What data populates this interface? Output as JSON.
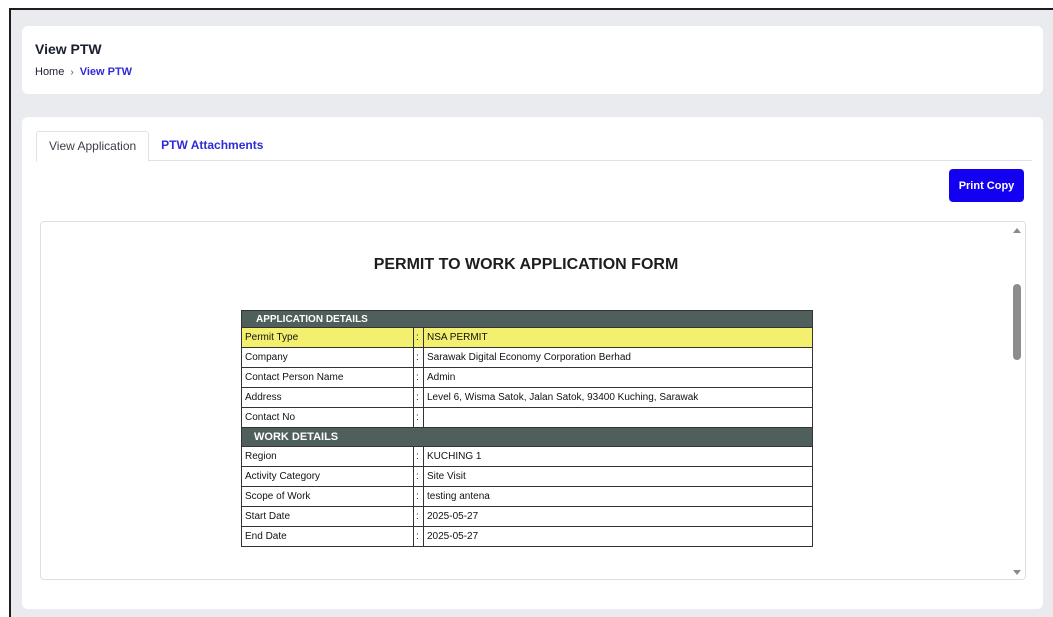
{
  "header": {
    "title": "View PTW",
    "breadcrumb": {
      "home": "Home",
      "separator": "›",
      "current": "View PTW"
    }
  },
  "tabs": [
    {
      "label": "View Application",
      "active": true
    },
    {
      "label": "PTW Attachments",
      "active": false
    }
  ],
  "toolbar": {
    "print_label": "Print Copy"
  },
  "document": {
    "title": "PERMIT TO WORK APPLICATION FORM",
    "sections": {
      "application": {
        "heading": "APPLICATION DETAILS",
        "rows": [
          {
            "label": "Permit Type",
            "value": "NSA PERMIT"
          },
          {
            "label": "Company",
            "value": "Sarawak Digital Economy Corporation Berhad"
          },
          {
            "label": "Contact Person Name",
            "value": "Admin"
          },
          {
            "label": "Address",
            "value": "Level 6, Wisma Satok, Jalan Satok, 93400 Kuching, Sarawak"
          },
          {
            "label": "Contact No",
            "value": ""
          }
        ]
      },
      "work": {
        "heading": "WORK DETAILS",
        "rows": [
          {
            "label": "Region",
            "value": "KUCHING 1"
          },
          {
            "label": "Activity Category",
            "value": "Site Visit"
          },
          {
            "label": "Scope of Work",
            "value": "testing antena"
          },
          {
            "label": "Start Date",
            "value": "2025-05-27"
          },
          {
            "label": "End Date",
            "value": "2025-05-27"
          }
        ]
      }
    },
    "colon": ":"
  },
  "colors": {
    "accent": "#1400f0",
    "link": "#2f2bd9",
    "section_header": "#4f5f5c",
    "highlight_row": "#f3f06f"
  }
}
